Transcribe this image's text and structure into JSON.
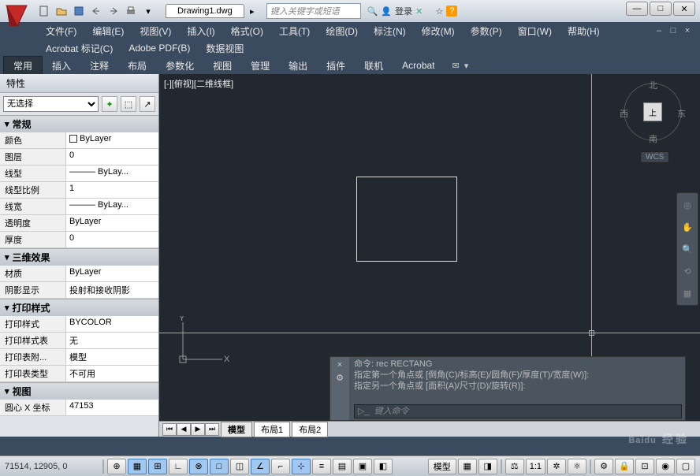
{
  "title": {
    "doc": "Drawing1.dwg",
    "search_ph": "键入关键字或短语",
    "login": "登录"
  },
  "win": {
    "min": "—",
    "max": "□",
    "close": "✕"
  },
  "menu1": [
    "文件(F)",
    "编辑(E)",
    "视图(V)",
    "插入(I)",
    "格式(O)",
    "工具(T)",
    "绘图(D)",
    "标注(N)",
    "修改(M)",
    "参数(P)",
    "窗口(W)",
    "帮助(H)"
  ],
  "menu2": [
    "Acrobat 标记(C)",
    "Adobe PDF(B)",
    "数据视图"
  ],
  "rtabs": [
    "常用",
    "插入",
    "注释",
    "布局",
    "参数化",
    "视图",
    "管理",
    "输出",
    "插件",
    "联机",
    "Acrobat"
  ],
  "props": {
    "title": "特性",
    "noSel": "无选择",
    "general": {
      "hdr": "常规",
      "rows": [
        {
          "l": "颜色",
          "v": "ByLayer",
          "box": true
        },
        {
          "l": "图层",
          "v": "0"
        },
        {
          "l": "线型",
          "v": "——— ByLay..."
        },
        {
          "l": "线型比例",
          "v": "1"
        },
        {
          "l": "线宽",
          "v": "——— ByLay..."
        },
        {
          "l": "透明度",
          "v": "ByLayer"
        },
        {
          "l": "厚度",
          "v": "0"
        }
      ]
    },
    "fx": {
      "hdr": "三维效果",
      "rows": [
        {
          "l": "材质",
          "v": "ByLayer"
        },
        {
          "l": "阴影显示",
          "v": "投射和接收阴影"
        }
      ]
    },
    "plot": {
      "hdr": "打印样式",
      "rows": [
        {
          "l": "打印样式",
          "v": "BYCOLOR"
        },
        {
          "l": "打印样式表",
          "v": "无"
        },
        {
          "l": "打印表附...",
          "v": "模型"
        },
        {
          "l": "打印表类型",
          "v": "不可用"
        }
      ]
    },
    "view": {
      "hdr": "视图",
      "rows": [
        {
          "l": "圆心 X 坐标",
          "v": "47153"
        }
      ]
    }
  },
  "viewport": {
    "label": "[-][俯视][二维线框]"
  },
  "viewcube": {
    "n": "北",
    "s": "南",
    "e": "东",
    "w": "西",
    "top": "上",
    "wcs": "WCS"
  },
  "cmd": {
    "l1": "命令: rec RECTANG",
    "l2": "指定第一个角点或 [倒角(C)/标高(E)/圆角(F)/厚度(T)/宽度(W)]:",
    "l3": "指定另一个角点或 [面积(A)/尺寸(D)/旋转(R)]:",
    "prompt": "键入命令"
  },
  "mtabs": {
    "model": "模型",
    "l1": "布局1",
    "l2": "布局2"
  },
  "status": {
    "coords": "71514, 12905, 0",
    "model": "模型",
    "scale": "1:1"
  },
  "watermark": {
    "main": "Baidu",
    "sub": "经验"
  }
}
